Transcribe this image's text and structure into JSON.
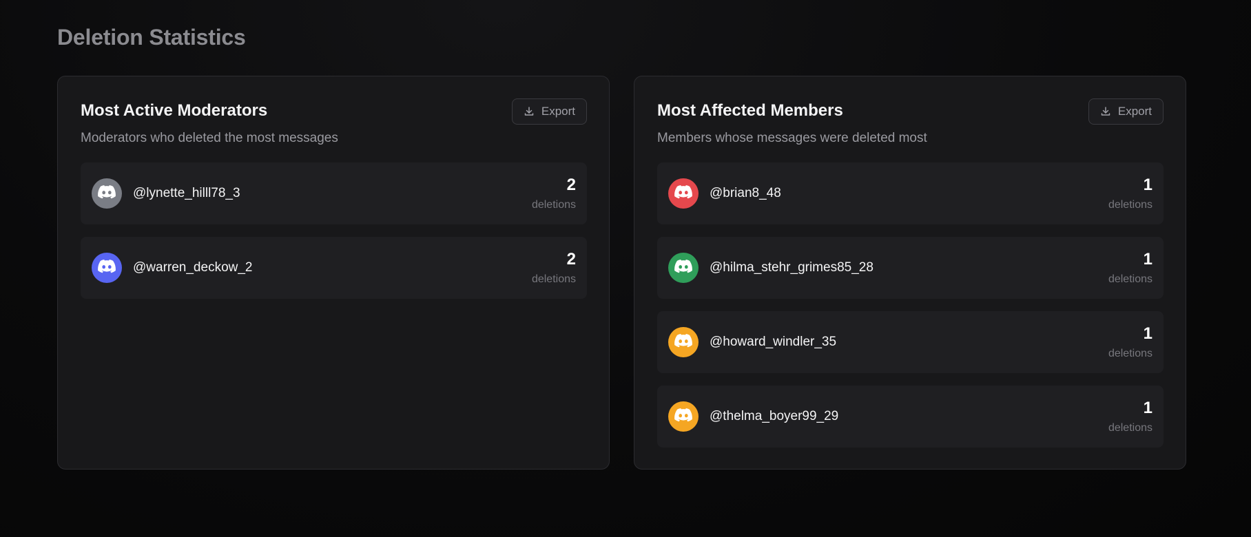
{
  "page": {
    "title": "Deletion Statistics"
  },
  "moderators": {
    "title": "Most Active Moderators",
    "subtitle": "Moderators who deleted the most messages",
    "export_label": "Export",
    "items": [
      {
        "username": "@lynette_hilll78_3",
        "count": "2",
        "count_label": "deletions",
        "avatar_color": "#7a7d85",
        "icon": "discord-icon"
      },
      {
        "username": "@warren_deckow_2",
        "count": "2",
        "count_label": "deletions",
        "avatar_color": "#5865f2",
        "icon": "discord-icon"
      }
    ]
  },
  "members": {
    "title": "Most Affected Members",
    "subtitle": "Members whose messages were deleted most",
    "export_label": "Export",
    "items": [
      {
        "username": "@brian8_48",
        "count": "1",
        "count_label": "deletions",
        "avatar_color": "#e5484d",
        "icon": "discord-icon"
      },
      {
        "username": "@hilma_stehr_grimes85_28",
        "count": "1",
        "count_label": "deletions",
        "avatar_color": "#2f9e5a",
        "icon": "discord-icon"
      },
      {
        "username": "@howard_windler_35",
        "count": "1",
        "count_label": "deletions",
        "avatar_color": "#f5a623",
        "icon": "discord-icon"
      },
      {
        "username": "@thelma_boyer99_29",
        "count": "1",
        "count_label": "deletions",
        "avatar_color": "#f5a623",
        "icon": "discord-icon"
      }
    ]
  }
}
